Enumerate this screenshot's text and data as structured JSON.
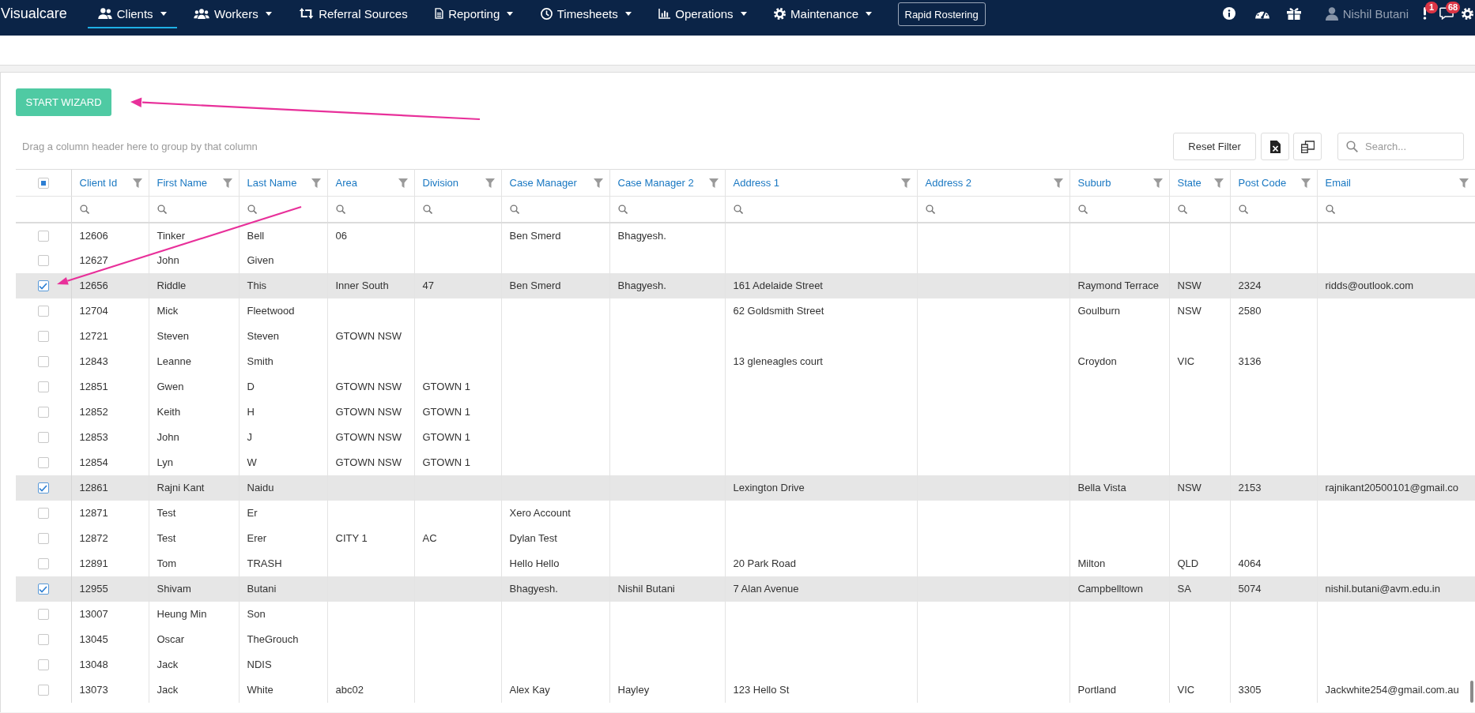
{
  "nav": {
    "brand": "Visualcare",
    "items": [
      {
        "label": "Clients",
        "dropdown": true,
        "selected": true
      },
      {
        "label": "Workers",
        "dropdown": true,
        "selected": false
      },
      {
        "label": "Referral Sources",
        "dropdown": false,
        "selected": false
      },
      {
        "label": "Reporting",
        "dropdown": true,
        "selected": false
      },
      {
        "label": "Timesheets",
        "dropdown": true,
        "selected": false
      },
      {
        "label": "Operations",
        "dropdown": true,
        "selected": false
      },
      {
        "label": "Maintenance",
        "dropdown": true,
        "selected": false
      }
    ],
    "rapid_button": "Rapid Rostering",
    "user": "Nishil Butani",
    "alerts": [
      {
        "kind": "alert",
        "badge": "1"
      },
      {
        "kind": "messages",
        "badge": "68"
      }
    ]
  },
  "wizard_button": "START WIZARD",
  "grid": {
    "group_panel": "Drag a column header here to group by that column",
    "reset_button": "Reset Filter",
    "search": {
      "placeholder": "Search..."
    },
    "select_all": {
      "indeterminate": true
    },
    "columns": [
      "Client Id",
      "First Name",
      "Last Name",
      "Area",
      "Division",
      "Case Manager",
      "Case Manager 2",
      "Address 1",
      "Address 2",
      "Suburb",
      "State",
      "Post Code",
      "Email"
    ],
    "rows": [
      {
        "selected": false,
        "client_id": "12606",
        "first_name": "Tinker",
        "last_name": "Bell",
        "area": "06",
        "case_manager": "Ben Smerd",
        "case_manager_2": "Bhagyesh."
      },
      {
        "selected": false,
        "client_id": "12627",
        "first_name": "John",
        "last_name": "Given"
      },
      {
        "selected": true,
        "client_id": "12656",
        "first_name": "Riddle",
        "last_name": "This",
        "area": "Inner South",
        "division": "47",
        "case_manager": "Ben Smerd",
        "case_manager_2": "Bhagyesh.",
        "address_1": "161 Adelaide Street",
        "suburb": "Raymond Terrace",
        "state": "NSW",
        "post_code": "2324",
        "email": "ridds@outlook.com"
      },
      {
        "selected": false,
        "client_id": "12704",
        "first_name": "Mick",
        "last_name": "Fleetwood",
        "address_1": "62 Goldsmith Street",
        "suburb": "Goulburn",
        "state": "NSW",
        "post_code": "2580"
      },
      {
        "selected": false,
        "client_id": "12721",
        "first_name": "Steven",
        "last_name": "Steven",
        "area": "GTOWN NSW"
      },
      {
        "selected": false,
        "client_id": "12843",
        "first_name": "Leanne",
        "last_name": "Smith",
        "address_1": "13 gleneagles court",
        "suburb": "Croydon",
        "state": "VIC",
        "post_code": "3136"
      },
      {
        "selected": false,
        "client_id": "12851",
        "first_name": "Gwen",
        "last_name": "D",
        "area": "GTOWN NSW",
        "division": "GTOWN 1"
      },
      {
        "selected": false,
        "client_id": "12852",
        "first_name": "Keith",
        "last_name": "H",
        "area": "GTOWN NSW",
        "division": "GTOWN 1"
      },
      {
        "selected": false,
        "client_id": "12853",
        "first_name": "John",
        "last_name": "J",
        "area": "GTOWN NSW",
        "division": "GTOWN 1"
      },
      {
        "selected": false,
        "client_id": "12854",
        "first_name": "Lyn",
        "last_name": "W",
        "area": "GTOWN NSW",
        "division": "GTOWN 1"
      },
      {
        "selected": true,
        "client_id": "12861",
        "first_name": "Rajni Kant",
        "last_name": "Naidu",
        "address_1": "Lexington Drive",
        "suburb": "Bella Vista",
        "state": "NSW",
        "post_code": "2153",
        "email": "rajnikant20500101@gmail.co"
      },
      {
        "selected": false,
        "client_id": "12871",
        "first_name": "Test",
        "last_name": "Er",
        "case_manager": "Xero Account"
      },
      {
        "selected": false,
        "client_id": "12872",
        "first_name": "Test",
        "last_name": "Erer",
        "area": "CITY 1",
        "division": "AC",
        "case_manager": "Dylan Test"
      },
      {
        "selected": false,
        "client_id": "12891",
        "first_name": "Tom",
        "last_name": "TRASH",
        "case_manager": "Hello Hello",
        "address_1": "20 Park Road",
        "suburb": "Milton",
        "state": "QLD",
        "post_code": "4064"
      },
      {
        "selected": true,
        "client_id": "12955",
        "first_name": "Shivam",
        "last_name": "Butani",
        "case_manager": "Bhagyesh.",
        "case_manager_2": "Nishil Butani",
        "address_1": "7 Alan Avenue",
        "suburb": "Campbelltown",
        "state": "SA",
        "post_code": "5074",
        "email": "nishil.butani@avm.edu.in"
      },
      {
        "selected": false,
        "client_id": "13007",
        "first_name": "Heung Min",
        "last_name": "Son"
      },
      {
        "selected": false,
        "client_id": "13045",
        "first_name": "Oscar",
        "last_name": "TheGrouch"
      },
      {
        "selected": false,
        "client_id": "13048",
        "first_name": "Jack",
        "last_name": "NDIS"
      },
      {
        "selected": false,
        "client_id": "13073",
        "first_name": "Jack",
        "last_name": "White",
        "area": "abc02",
        "case_manager": "Alex Kay",
        "case_manager_2": "Hayley",
        "address_1": "123 Hello St",
        "suburb": "Portland",
        "state": "VIC",
        "post_code": "3305",
        "email": "Jackwhite254@gmail.com.au"
      }
    ]
  }
}
